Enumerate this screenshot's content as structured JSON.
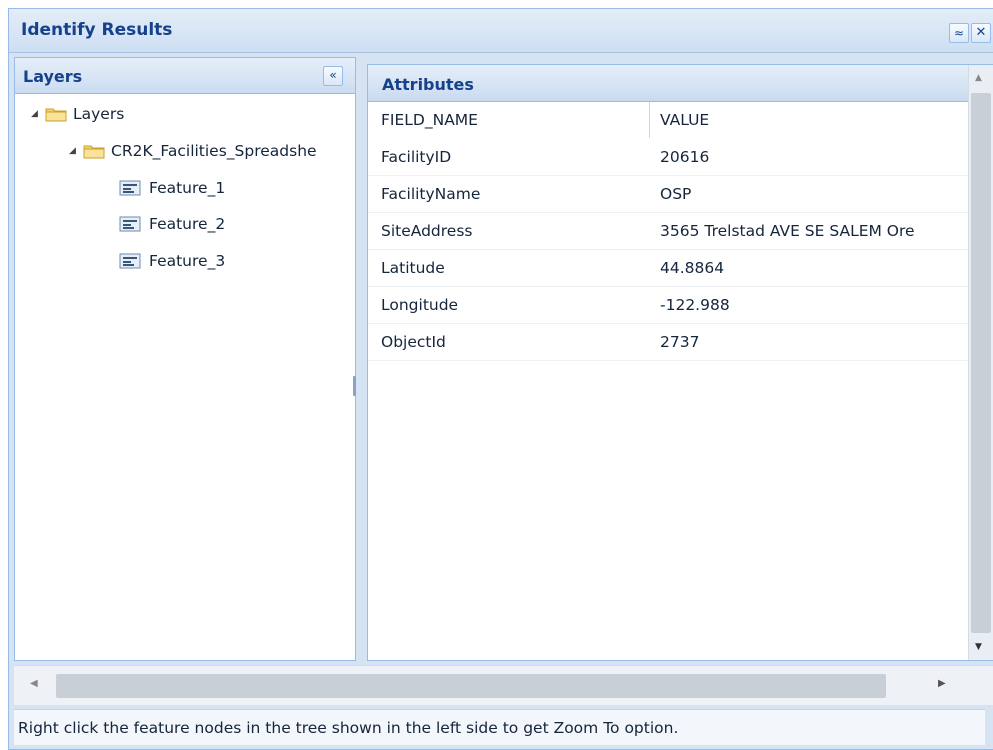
{
  "window": {
    "title": "Identify Results",
    "collapse_glyph": "≈",
    "close_glyph": "✕"
  },
  "layers": {
    "title": "Layers",
    "collapse_glyph": "«",
    "tree": [
      {
        "label": "Layers",
        "icon": "folder-icon",
        "expanded": true
      },
      {
        "label": "CR2K_Facilities_Spreadshe",
        "icon": "folder-icon",
        "expanded": true
      },
      {
        "label": "Feature_1",
        "icon": "feature-icon"
      },
      {
        "label": "Feature_2",
        "icon": "feature-icon"
      },
      {
        "label": "Feature_3",
        "icon": "feature-icon"
      }
    ]
  },
  "attributes": {
    "title": "Attributes",
    "columns": [
      "FIELD_NAME",
      "VALUE"
    ],
    "rows": [
      {
        "field": "FacilityID",
        "value": "20616"
      },
      {
        "field": "FacilityName",
        "value": "OSP"
      },
      {
        "field": "SiteAddress",
        "value": "3565 Trelstad AVE SE SALEM Ore"
      },
      {
        "field": "Latitude",
        "value": "44.8864"
      },
      {
        "field": "Longitude",
        "value": "-122.988"
      },
      {
        "field": "ObjectId",
        "value": "2737"
      }
    ]
  },
  "status": {
    "message": "Right click the feature nodes in the tree shown in the left side to get Zoom To option."
  },
  "colors": {
    "header_text": "#15428b",
    "border": "#99bbe8",
    "folder": "#f2c94c"
  }
}
